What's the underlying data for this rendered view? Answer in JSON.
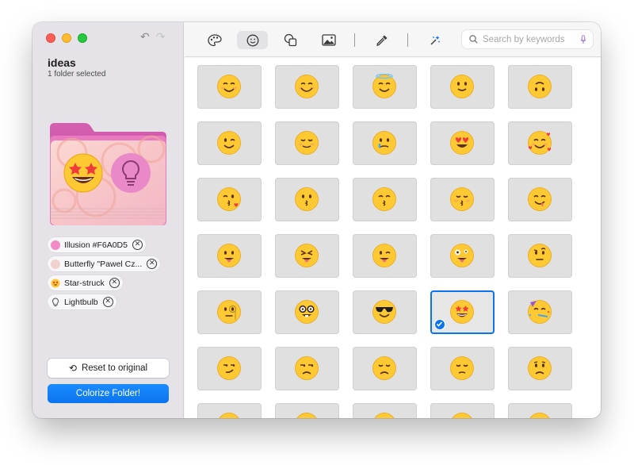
{
  "sidebar": {
    "folder_name": "ideas",
    "folder_subtitle": "1 folder selected",
    "chips": [
      {
        "label": "Illusion #F6A0D5",
        "swatch_color": "#f18cc7",
        "icon": "color-swatch"
      },
      {
        "label": "Butterfly \"Pawel Cz...",
        "swatch_color": "#f1d2cf",
        "icon": "pattern-swatch"
      },
      {
        "label": "Star-struck",
        "swatch_color": "#f5b819",
        "icon": "star-struck-emoji"
      },
      {
        "label": "Lightbulb",
        "swatch_color": "#ffffff",
        "icon": "lightbulb-icon"
      }
    ],
    "reset_label": "Reset to original",
    "colorize_label": "Colorize Folder!"
  },
  "toolbar": {
    "tools": [
      "palette-icon",
      "emoji-icon",
      "shapes-icon",
      "image-icon",
      "eyedropper-icon",
      "sparkle-icon"
    ],
    "active_tool": "emoji-icon",
    "search_placeholder": "Search by keywords"
  },
  "colors": {
    "accent": "#0a74f0",
    "folder": "#d05aa8",
    "emoji_yellow": "#ffc933"
  },
  "emoji_grid": {
    "selected": "star-struck",
    "items": [
      [
        "smiling-face",
        "smiling-face-with-smiling-eyes",
        "smiling-face-with-halo",
        "slightly-smiling-face",
        "upside-down-face"
      ],
      [
        "winking-face",
        "relieved-face",
        "face-holding-back-tears",
        "smiling-face-with-heart-eyes",
        "smiling-face-with-hearts"
      ],
      [
        "face-blowing-a-kiss",
        "kissing-face",
        "kissing-face-with-smiling-eyes",
        "kissing-face-with-closed-eyes",
        "face-savoring-food"
      ],
      [
        "face-with-tongue",
        "squinting-face-with-tongue",
        "winking-face-with-tongue",
        "zany-face",
        "face-with-raised-eyebrow"
      ],
      [
        "face-with-monocle",
        "nerd-face",
        "smiling-face-with-sunglasses",
        "star-struck",
        "partying-face"
      ],
      [
        "smirking-face",
        "unamused-face",
        "disappointed-face",
        "pensive-face",
        "worried-face"
      ],
      [
        "grinning-face",
        "grinning-face",
        "grinning-face",
        "grinning-face",
        "grinning-face"
      ]
    ]
  }
}
